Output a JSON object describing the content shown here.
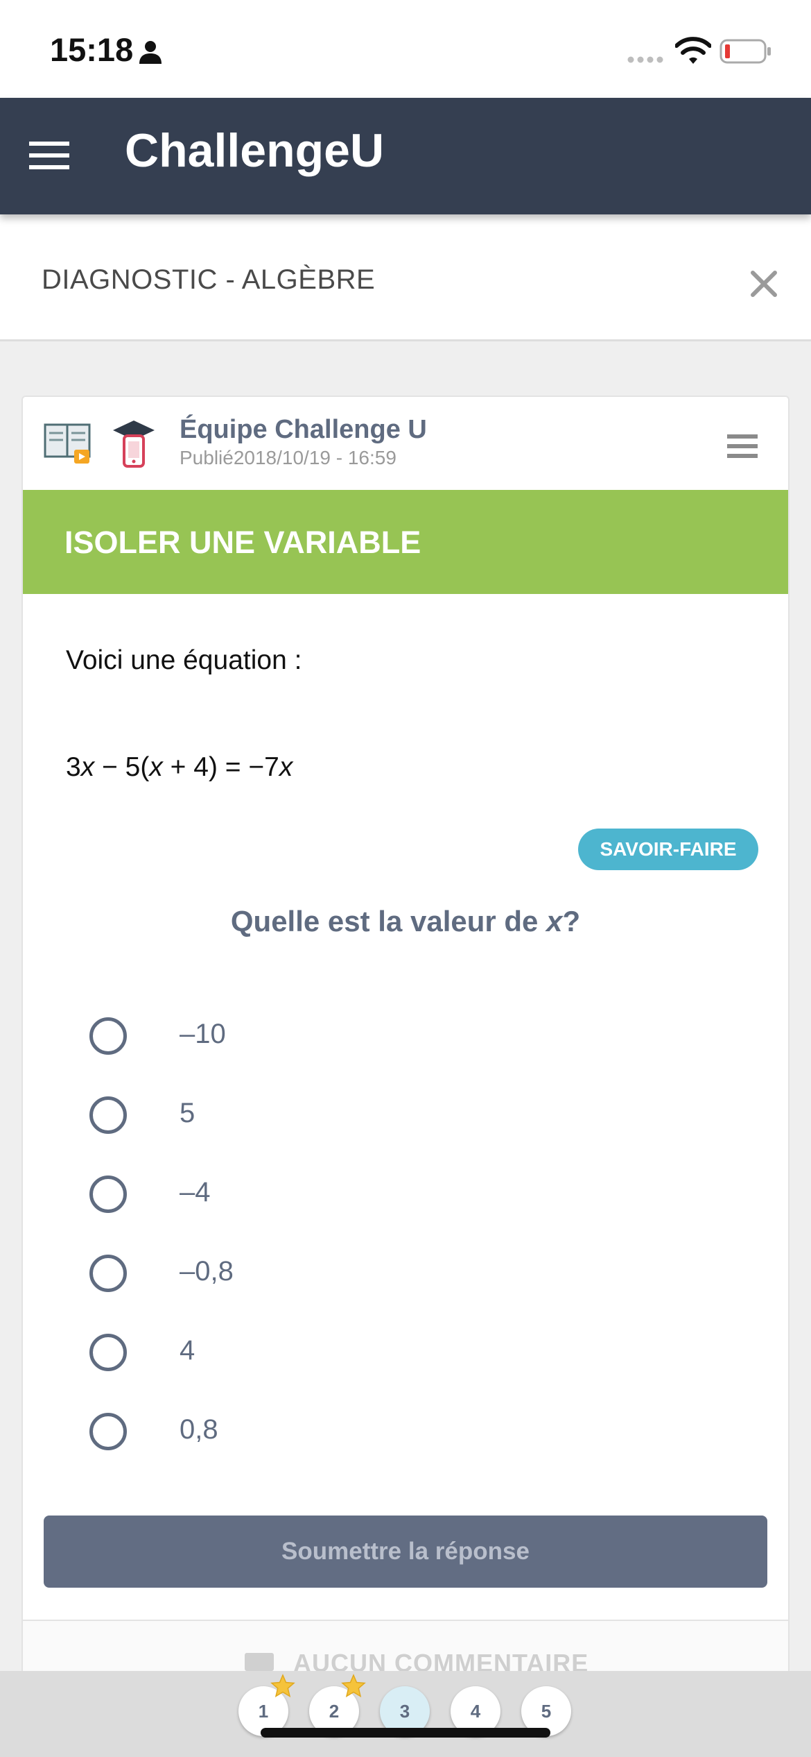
{
  "status_bar": {
    "time": "15:18"
  },
  "app": {
    "title": "ChallengeU"
  },
  "sub_header": {
    "title": "DIAGNOSTIC - ALGÈBRE"
  },
  "card": {
    "author": "Équipe Challenge U",
    "published": "Publié2018/10/19 - 16:59",
    "topic": "ISOLER UNE VARIABLE",
    "intro": "Voici une équation :",
    "equation": {
      "p1": "3",
      "v1": "x",
      "p2": " − 5(",
      "v2": "x",
      "p3": " + 4) = −7",
      "v3": "x"
    },
    "skill_badge": "SAVOIR-FAIRE",
    "question": {
      "prefix": "Quelle est la valeur de ",
      "var": "x",
      "suffix": "?"
    },
    "options": [
      "–10",
      "5",
      "–4",
      "–0,8",
      "4",
      "0,8"
    ],
    "submit_label": "Soumettre la réponse",
    "comments_label": "AUCUN COMMENTAIRE"
  },
  "pager": {
    "pages": [
      "1",
      "2",
      "3",
      "4",
      "5"
    ],
    "active_page": "3",
    "starred_pages": [
      "1",
      "2"
    ]
  },
  "colors": {
    "header": "#353f51",
    "topic_banner": "#97c454",
    "skill_badge": "#4db5cf",
    "submit_button": "#626d83",
    "text_muted": "#5f6b80"
  }
}
